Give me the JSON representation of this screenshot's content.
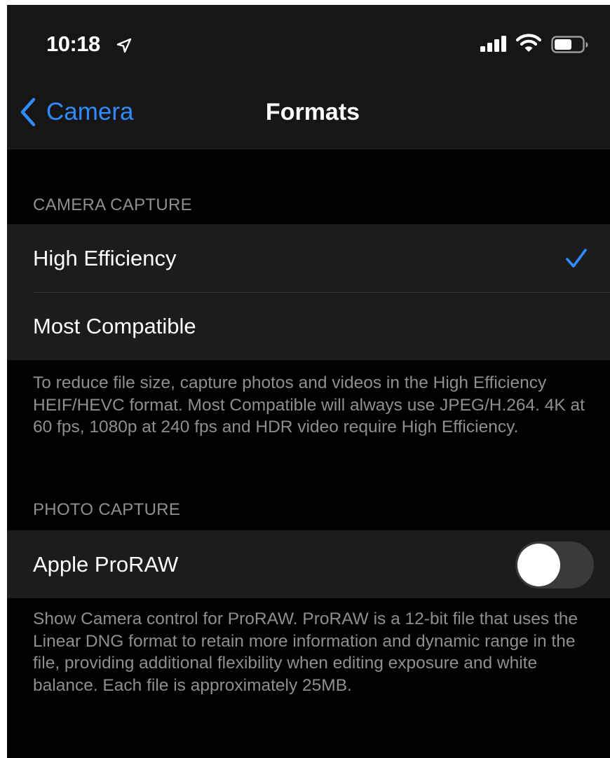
{
  "status_bar": {
    "time": "10:18",
    "icons": [
      "location-arrow-icon",
      "cellular-signal-icon",
      "wifi-icon",
      "battery-icon"
    ]
  },
  "nav": {
    "back_label": "Camera",
    "title": "Formats"
  },
  "camera_capture": {
    "header": "CAMERA CAPTURE",
    "options": [
      {
        "label": "High Efficiency",
        "selected": true
      },
      {
        "label": "Most Compatible",
        "selected": false
      }
    ],
    "footer": "To reduce file size, capture photos and videos in the High Efficiency HEIF/HEVC format. Most Compatible will always use JPEG/H.264. 4K at 60 fps, 1080p at 240 fps and HDR video require High Efficiency."
  },
  "photo_capture": {
    "header": "PHOTO CAPTURE",
    "proraw": {
      "label": "Apple ProRAW",
      "enabled": false
    },
    "footer": "Show Camera control for ProRAW. ProRAW is a 12-bit file that uses the Linear DNG format to retain more information and dynamic range in the file, providing additional flexibility when editing exposure and white balance. Each file is approximately 25MB."
  },
  "colors": {
    "accent": "#2f8bff",
    "background": "#000000",
    "cell": "#1c1c1e",
    "secondary_text": "#8e8e93"
  }
}
